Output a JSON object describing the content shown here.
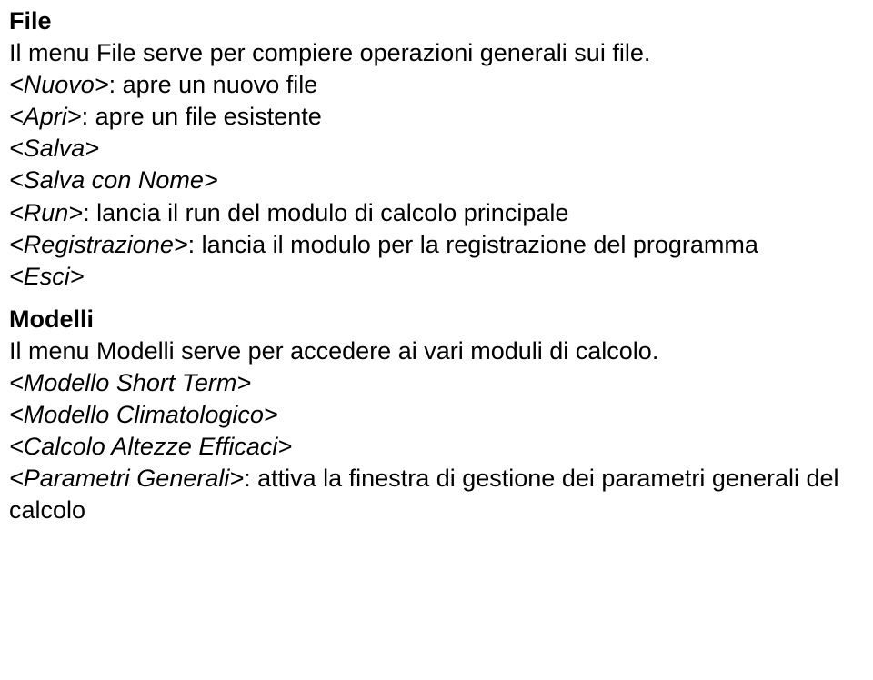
{
  "file": {
    "heading": "File",
    "intro": "Il menu File serve per compiere operazioni generali sui file.",
    "nuovo_label": "<Nuovo>",
    "nuovo_desc": ": apre un nuovo file",
    "apri_label": "<Apri>",
    "apri_desc": ": apre un file esistente",
    "salva_label": "<Salva>",
    "salva_nome_label": "<Salva con Nome>",
    "run_label": "<Run>",
    "run_desc": ": lancia il run del modulo di calcolo principale",
    "reg_label": "<Registrazione>",
    "reg_desc": ": lancia il modulo per la registrazione del programma",
    "esci_label": "<Esci>"
  },
  "modelli": {
    "heading": "Modelli",
    "intro": "Il menu Modelli serve per accedere ai vari moduli di calcolo.",
    "short_label": "<Modello Short Term>",
    "clim_label": "<Modello Climatologico>",
    "altezze_label": "<Calcolo Altezze Efficaci>",
    "param_label": "<Parametri Generali>",
    "param_desc": ": attiva la finestra di gestione dei parametri generali del calcolo"
  }
}
